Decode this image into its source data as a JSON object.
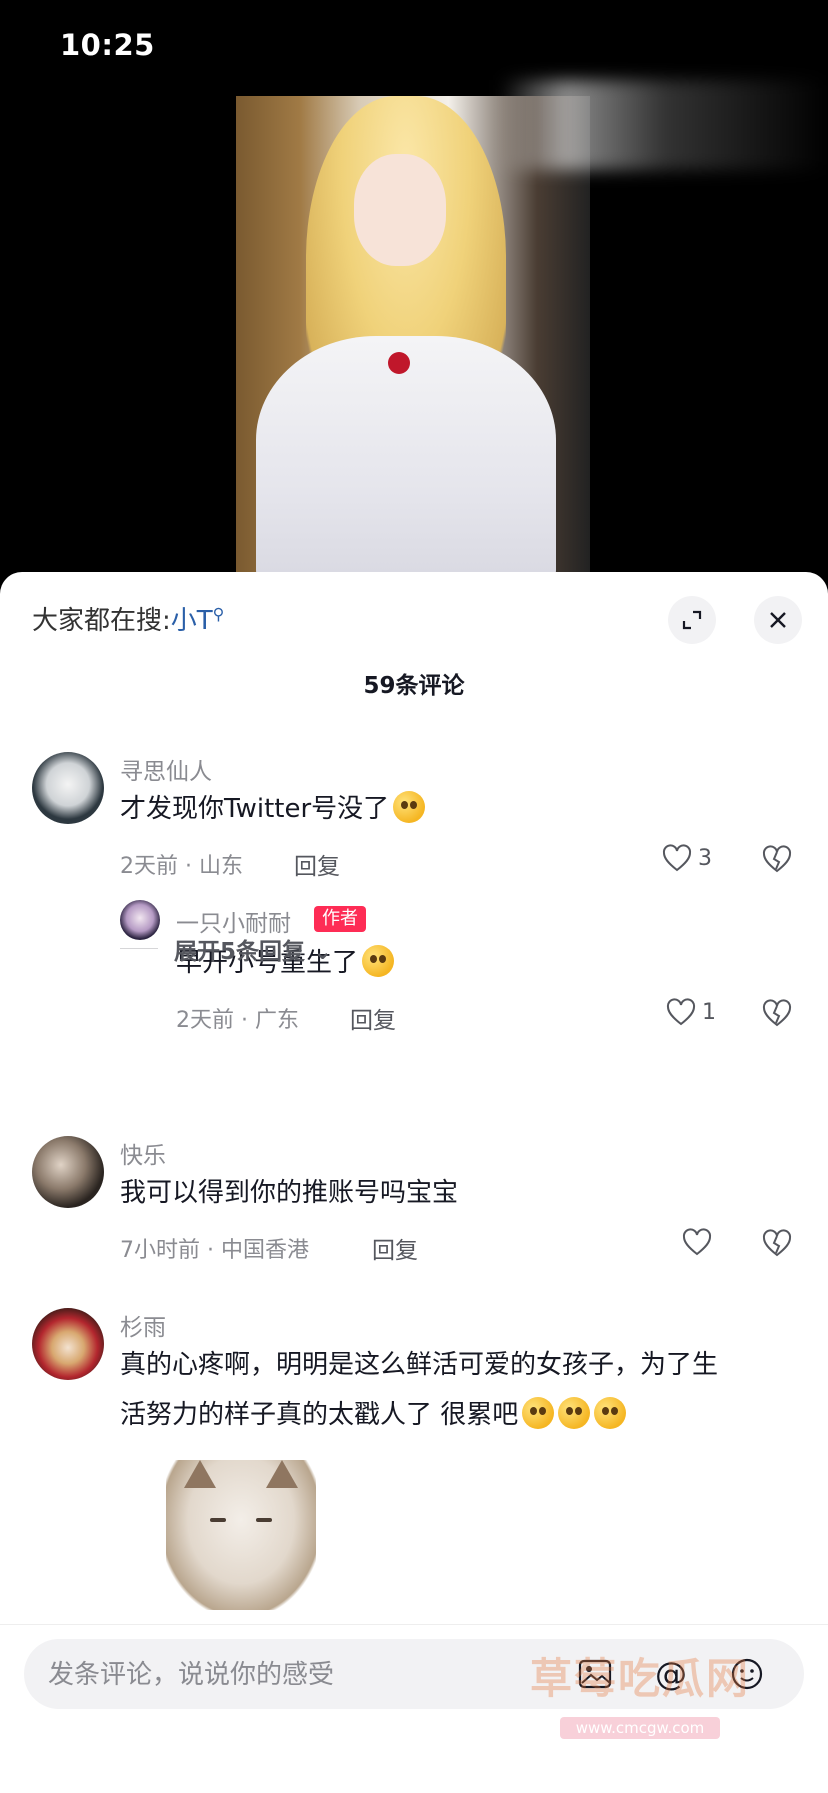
{
  "status_bar": {
    "time": "10:25"
  },
  "sheet": {
    "search_prefix": "大家都在搜:",
    "search_keyword": "小T",
    "comment_count": "59条评论"
  },
  "comments": [
    {
      "username": "寻思仙人",
      "text": "才发现你Twitter号没了",
      "meta": "2天前 · 山东",
      "reply_label": "回复",
      "likes": "3",
      "replies": [
        {
          "username": "一只小耐耐",
          "badge": "作者",
          "text": "早开小号重生了",
          "meta": "2天前 · 广东",
          "reply_label": "回复",
          "likes": "1"
        }
      ],
      "expand_label": "展开5条回复"
    },
    {
      "username": "快乐",
      "text": "我可以得到你的推账号吗宝宝",
      "meta": "7小时前 · 中国香港",
      "reply_label": "回复"
    },
    {
      "username": "杉雨",
      "text_line1": "真的心疼啊，明明是这么鲜活可爱的女孩子，为了生",
      "text_line2": "活努力的样子真的太戳人了 很累吧"
    }
  ],
  "composer": {
    "placeholder": "发条评论，说说你的感受"
  },
  "watermark": {
    "text": "草莓吃瓜网",
    "url": "www.cmcgw.com"
  },
  "colors": {
    "author_badge": "#fe2c55",
    "search_keyword": "#2a5fa8"
  }
}
